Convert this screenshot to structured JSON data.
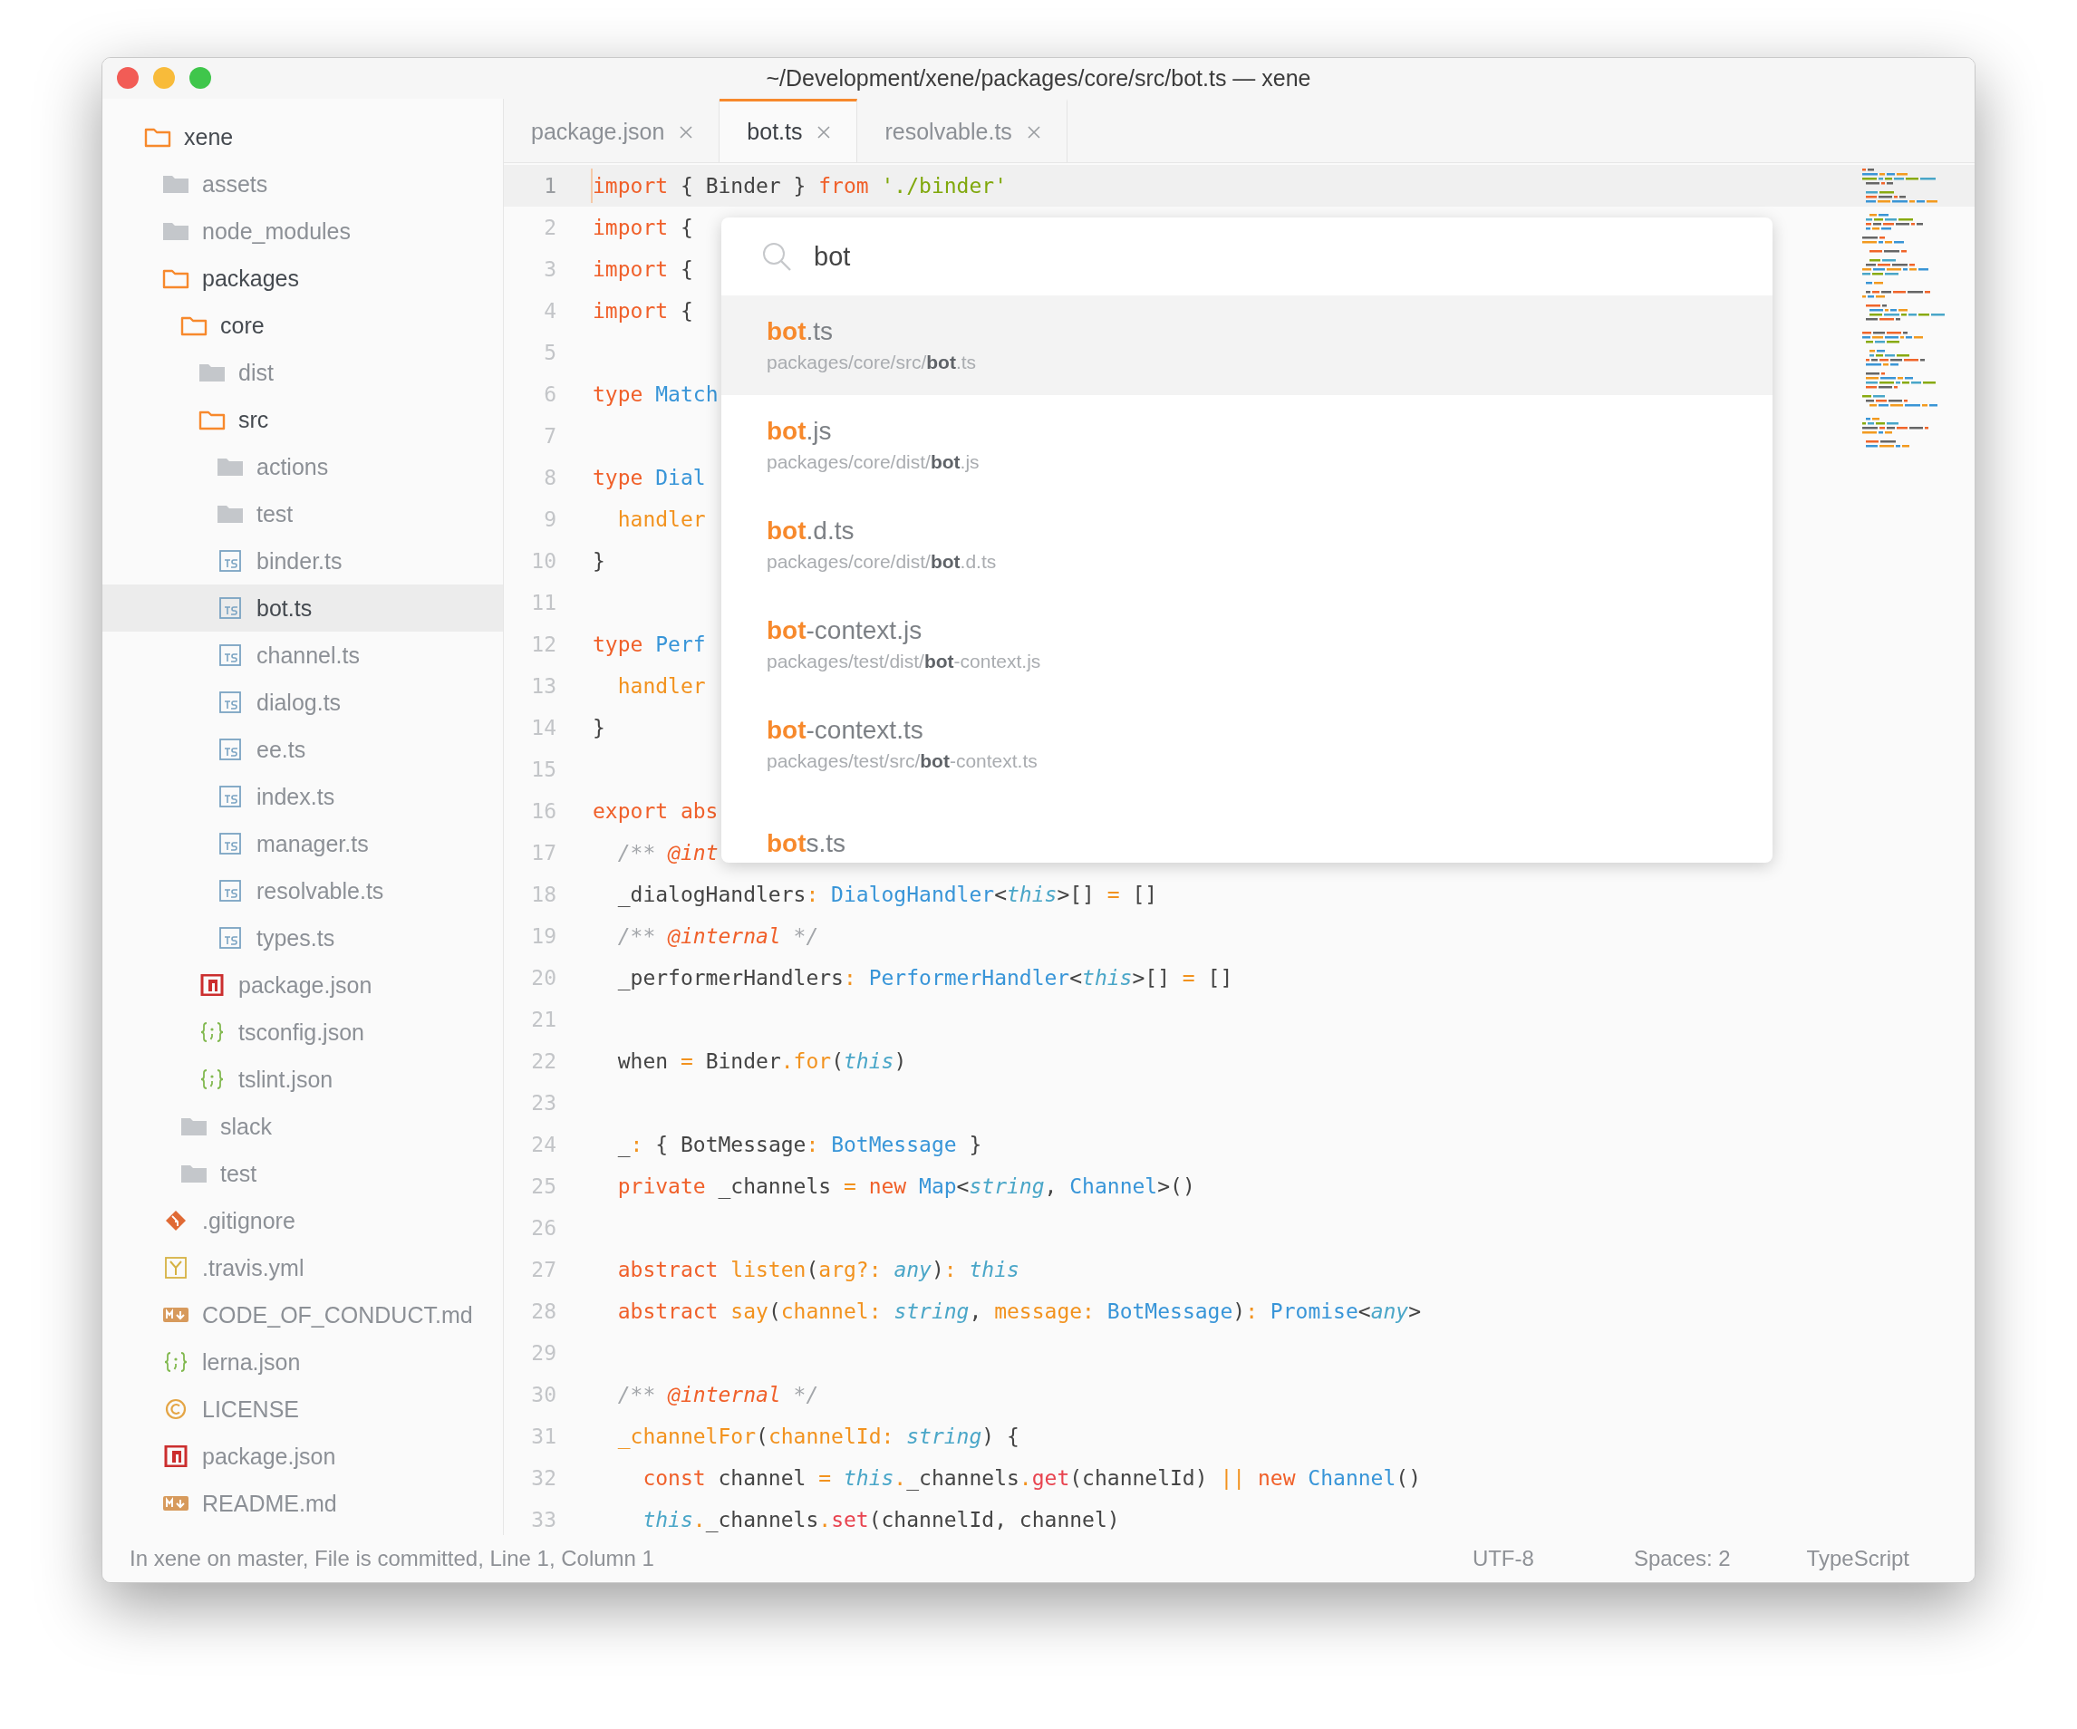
{
  "window": {
    "title": "~/Development/xene/packages/core/src/bot.ts — xene"
  },
  "sidebar": {
    "items": [
      {
        "label": "xene",
        "kind": "folder",
        "expanded": true,
        "selected": false,
        "children": [
          {
            "label": "assets",
            "kind": "folder",
            "expanded": false,
            "selected": false
          },
          {
            "label": "node_modules",
            "kind": "folder",
            "expanded": false,
            "selected": false
          },
          {
            "label": "packages",
            "kind": "folder",
            "expanded": true,
            "selected": false,
            "children": [
              {
                "label": "core",
                "kind": "folder",
                "expanded": true,
                "selected": false,
                "children": [
                  {
                    "label": "dist",
                    "kind": "folder",
                    "expanded": false,
                    "selected": false
                  },
                  {
                    "label": "src",
                    "kind": "folder",
                    "expanded": true,
                    "selected": false,
                    "children": [
                      {
                        "label": "actions",
                        "kind": "folder",
                        "expanded": false,
                        "selected": false
                      },
                      {
                        "label": "test",
                        "kind": "folder",
                        "expanded": false,
                        "selected": false
                      },
                      {
                        "label": "binder.ts",
                        "kind": "ts",
                        "selected": false
                      },
                      {
                        "label": "bot.ts",
                        "kind": "ts",
                        "selected": true
                      },
                      {
                        "label": "channel.ts",
                        "kind": "ts",
                        "selected": false
                      },
                      {
                        "label": "dialog.ts",
                        "kind": "ts",
                        "selected": false
                      },
                      {
                        "label": "ee.ts",
                        "kind": "ts",
                        "selected": false
                      },
                      {
                        "label": "index.ts",
                        "kind": "ts",
                        "selected": false
                      },
                      {
                        "label": "manager.ts",
                        "kind": "ts",
                        "selected": false
                      },
                      {
                        "label": "resolvable.ts",
                        "kind": "ts",
                        "selected": false
                      },
                      {
                        "label": "types.ts",
                        "kind": "ts",
                        "selected": false
                      }
                    ]
                  },
                  {
                    "label": "package.json",
                    "kind": "npm",
                    "selected": false
                  },
                  {
                    "label": "tsconfig.json",
                    "kind": "json",
                    "selected": false
                  },
                  {
                    "label": "tslint.json",
                    "kind": "json",
                    "selected": false
                  }
                ]
              },
              {
                "label": "slack",
                "kind": "folder",
                "expanded": false,
                "selected": false
              },
              {
                "label": "test",
                "kind": "folder",
                "expanded": false,
                "selected": false
              }
            ]
          },
          {
            "label": ".gitignore",
            "kind": "git",
            "selected": false
          },
          {
            "label": ".travis.yml",
            "kind": "yaml",
            "selected": false
          },
          {
            "label": "CODE_OF_CONDUCT.md",
            "kind": "markdown",
            "selected": false
          },
          {
            "label": "lerna.json",
            "kind": "json",
            "selected": false
          },
          {
            "label": "LICENSE",
            "kind": "license",
            "selected": false
          },
          {
            "label": "package.json",
            "kind": "npm",
            "selected": false
          },
          {
            "label": "README.md",
            "kind": "markdown",
            "selected": false
          }
        ]
      }
    ]
  },
  "tabs": [
    {
      "label": "package.json",
      "selected": false
    },
    {
      "label": "bot.ts",
      "selected": true
    },
    {
      "label": "resolvable.ts",
      "selected": false
    }
  ],
  "editor": {
    "lines": [
      {
        "number": "1",
        "current": true,
        "tokens": [
          {
            "text": "import",
            "kind": "kw"
          },
          {
            "text": " { Binder } ",
            "kind": "plain"
          },
          {
            "text": "from",
            "kind": "kw"
          },
          {
            "text": " './binder'",
            "kind": "str"
          }
        ]
      },
      {
        "number": "2",
        "current": false,
        "tokens": [
          {
            "text": "import",
            "kind": "kw"
          },
          {
            "text": " {",
            "kind": "plain"
          }
        ]
      },
      {
        "number": "3",
        "current": false,
        "tokens": [
          {
            "text": "import",
            "kind": "kw"
          },
          {
            "text": " {",
            "kind": "plain"
          }
        ]
      },
      {
        "number": "4",
        "current": false,
        "tokens": [
          {
            "text": "import",
            "kind": "kw"
          },
          {
            "text": " {",
            "kind": "plain"
          }
        ]
      },
      {
        "number": "5",
        "current": false
      },
      {
        "number": "6",
        "current": false,
        "tokens": [
          {
            "text": "type",
            "kind": "kw"
          },
          {
            "text": " Match",
            "kind": "type"
          }
        ]
      },
      {
        "number": "7",
        "current": false
      },
      {
        "number": "8",
        "current": false,
        "tokens": [
          {
            "text": "type",
            "kind": "kw"
          },
          {
            "text": " Dial",
            "kind": "type"
          }
        ]
      },
      {
        "number": "9",
        "current": false,
        "tokens": [
          {
            "text": "  handler",
            "kind": "fn"
          }
        ]
      },
      {
        "number": "10",
        "current": false,
        "tokens": [
          {
            "text": "}",
            "kind": "plain"
          }
        ]
      },
      {
        "number": "11",
        "current": false
      },
      {
        "number": "12",
        "current": false,
        "tokens": [
          {
            "text": "type",
            "kind": "kw"
          },
          {
            "text": " Perf",
            "kind": "type"
          }
        ]
      },
      {
        "number": "13",
        "current": false,
        "tokens": [
          {
            "text": "  handler",
            "kind": "fn"
          }
        ]
      },
      {
        "number": "14",
        "current": false,
        "tokens": [
          {
            "text": "}",
            "kind": "plain"
          }
        ]
      },
      {
        "number": "15",
        "current": false
      },
      {
        "number": "16",
        "current": false,
        "tokens": [
          {
            "text": "export abs",
            "kind": "kw"
          }
        ]
      },
      {
        "number": "17",
        "current": false,
        "tokens": [
          {
            "text": "  /** ",
            "kind": "cmt"
          },
          {
            "text": "@int",
            "kind": "tag"
          }
        ]
      },
      {
        "number": "18",
        "current": false,
        "tokens": [
          {
            "text": "  _dialogHandlers",
            "kind": "plain"
          },
          {
            "text": ":",
            "kind": "op"
          },
          {
            "text": " DialogHandler",
            "kind": "type"
          },
          {
            "text": "<",
            "kind": "plain"
          },
          {
            "text": "this",
            "kind": "builtin"
          },
          {
            "text": ">[] ",
            "kind": "plain"
          },
          {
            "text": "=",
            "kind": "op"
          },
          {
            "text": " []",
            "kind": "plain"
          }
        ]
      },
      {
        "number": "19",
        "current": false,
        "tokens": [
          {
            "text": "  /** ",
            "kind": "cmt"
          },
          {
            "text": "@internal",
            "kind": "tag"
          },
          {
            "text": " */",
            "kind": "cmt"
          }
        ]
      },
      {
        "number": "20",
        "current": false,
        "tokens": [
          {
            "text": "  _performerHandlers",
            "kind": "plain"
          },
          {
            "text": ":",
            "kind": "op"
          },
          {
            "text": " PerformerHandler",
            "kind": "type"
          },
          {
            "text": "<",
            "kind": "plain"
          },
          {
            "text": "this",
            "kind": "builtin"
          },
          {
            "text": ">[] ",
            "kind": "plain"
          },
          {
            "text": "=",
            "kind": "op"
          },
          {
            "text": " []",
            "kind": "plain"
          }
        ]
      },
      {
        "number": "21",
        "current": false
      },
      {
        "number": "22",
        "current": false,
        "tokens": [
          {
            "text": "  when ",
            "kind": "plain"
          },
          {
            "text": "=",
            "kind": "op"
          },
          {
            "text": " Binder",
            "kind": "plain"
          },
          {
            "text": ".",
            "kind": "op"
          },
          {
            "text": "for",
            "kind": "fn"
          },
          {
            "text": "(",
            "kind": "plain"
          },
          {
            "text": "this",
            "kind": "builtin"
          },
          {
            "text": ")",
            "kind": "plain"
          }
        ]
      },
      {
        "number": "23",
        "current": false
      },
      {
        "number": "24",
        "current": false,
        "tokens": [
          {
            "text": "  _",
            "kind": "plain"
          },
          {
            "text": ":",
            "kind": "op"
          },
          {
            "text": " { BotMessage",
            "kind": "plain"
          },
          {
            "text": ":",
            "kind": "op"
          },
          {
            "text": " BotMessage",
            "kind": "type"
          },
          {
            "text": " }",
            "kind": "plain"
          }
        ]
      },
      {
        "number": "25",
        "current": false,
        "tokens": [
          {
            "text": "  private",
            "kind": "kw"
          },
          {
            "text": " _channels ",
            "kind": "plain"
          },
          {
            "text": "=",
            "kind": "op"
          },
          {
            "text": " new",
            "kind": "kw"
          },
          {
            "text": " Map",
            "kind": "type"
          },
          {
            "text": "<",
            "kind": "plain"
          },
          {
            "text": "string",
            "kind": "builtin"
          },
          {
            "text": ", ",
            "kind": "plain"
          },
          {
            "text": "Channel",
            "kind": "type"
          },
          {
            "text": ">()",
            "kind": "plain"
          }
        ]
      },
      {
        "number": "26",
        "current": false
      },
      {
        "number": "27",
        "current": false,
        "tokens": [
          {
            "text": "  abstract",
            "kind": "kw"
          },
          {
            "text": " listen",
            "kind": "fn"
          },
          {
            "text": "(",
            "kind": "plain"
          },
          {
            "text": "arg?",
            "kind": "param"
          },
          {
            "text": ":",
            "kind": "op"
          },
          {
            "text": " any",
            "kind": "builtin"
          },
          {
            "text": ")",
            "kind": "plain"
          },
          {
            "text": ":",
            "kind": "op"
          },
          {
            "text": " this",
            "kind": "builtin"
          }
        ]
      },
      {
        "number": "28",
        "current": false,
        "tokens": [
          {
            "text": "  abstract",
            "kind": "kw"
          },
          {
            "text": " say",
            "kind": "fn"
          },
          {
            "text": "(",
            "kind": "plain"
          },
          {
            "text": "channel",
            "kind": "param"
          },
          {
            "text": ":",
            "kind": "op"
          },
          {
            "text": " string",
            "kind": "builtin"
          },
          {
            "text": ", ",
            "kind": "plain"
          },
          {
            "text": "message",
            "kind": "param"
          },
          {
            "text": ":",
            "kind": "op"
          },
          {
            "text": " BotMessage",
            "kind": "type"
          },
          {
            "text": ")",
            "kind": "plain"
          },
          {
            "text": ":",
            "kind": "op"
          },
          {
            "text": " Promise",
            "kind": "type"
          },
          {
            "text": "<",
            "kind": "plain"
          },
          {
            "text": "any",
            "kind": "builtin"
          },
          {
            "text": ">",
            "kind": "plain"
          }
        ]
      },
      {
        "number": "29",
        "current": false
      },
      {
        "number": "30",
        "current": false,
        "tokens": [
          {
            "text": "  /** ",
            "kind": "cmt"
          },
          {
            "text": "@internal",
            "kind": "tag"
          },
          {
            "text": " */",
            "kind": "cmt"
          }
        ]
      },
      {
        "number": "31",
        "current": false,
        "tokens": [
          {
            "text": "  _channelFor",
            "kind": "fn"
          },
          {
            "text": "(",
            "kind": "plain"
          },
          {
            "text": "channelId",
            "kind": "param"
          },
          {
            "text": ":",
            "kind": "op"
          },
          {
            "text": " string",
            "kind": "builtin"
          },
          {
            "text": ") {",
            "kind": "plain"
          }
        ]
      },
      {
        "number": "32",
        "current": false,
        "tokens": [
          {
            "text": "    const",
            "kind": "kw"
          },
          {
            "text": " channel ",
            "kind": "plain"
          },
          {
            "text": "=",
            "kind": "op"
          },
          {
            "text": " this",
            "kind": "builtin"
          },
          {
            "text": ".",
            "kind": "op"
          },
          {
            "text": "_channels",
            "kind": "plain"
          },
          {
            "text": ".",
            "kind": "op"
          },
          {
            "text": "get",
            "kind": "call"
          },
          {
            "text": "(channelId) ",
            "kind": "plain"
          },
          {
            "text": "||",
            "kind": "op"
          },
          {
            "text": " new",
            "kind": "kw"
          },
          {
            "text": " Channel",
            "kind": "type"
          },
          {
            "text": "()",
            "kind": "plain"
          }
        ]
      },
      {
        "number": "33",
        "current": false,
        "tokens": [
          {
            "text": "    this",
            "kind": "builtin"
          },
          {
            "text": ".",
            "kind": "op"
          },
          {
            "text": "_channels",
            "kind": "plain"
          },
          {
            "text": ".",
            "kind": "op"
          },
          {
            "text": "set",
            "kind": "call"
          },
          {
            "text": "(channelId, channel)",
            "kind": "plain"
          }
        ]
      }
    ]
  },
  "goto_anything": {
    "search": {
      "value": "bot"
    },
    "results": [
      {
        "title": "**bot**.ts",
        "path": "packages/core/src/**bot**.ts",
        "selected": true
      },
      {
        "title": "**bot**.js",
        "path": "packages/core/dist/**bot**.js",
        "selected": false
      },
      {
        "title": "**bot**.d.ts",
        "path": "packages/core/dist/**bot**.d.ts",
        "selected": false
      },
      {
        "title": "**bot**-context.js",
        "path": "packages/test/dist/**bot**-context.js",
        "selected": false
      },
      {
        "title": "**bot**-context.ts",
        "path": "packages/test/src/**bot**-context.ts",
        "selected": false
      },
      {
        "title": "**bot**s.ts",
        "selected": false
      }
    ]
  },
  "status_bar": {
    "message": "In xene on master, File is committed, Line 1, Column 1",
    "encoding": "UTF-8",
    "indentation": "Spaces: 2",
    "syntax": "TypeScript"
  }
}
